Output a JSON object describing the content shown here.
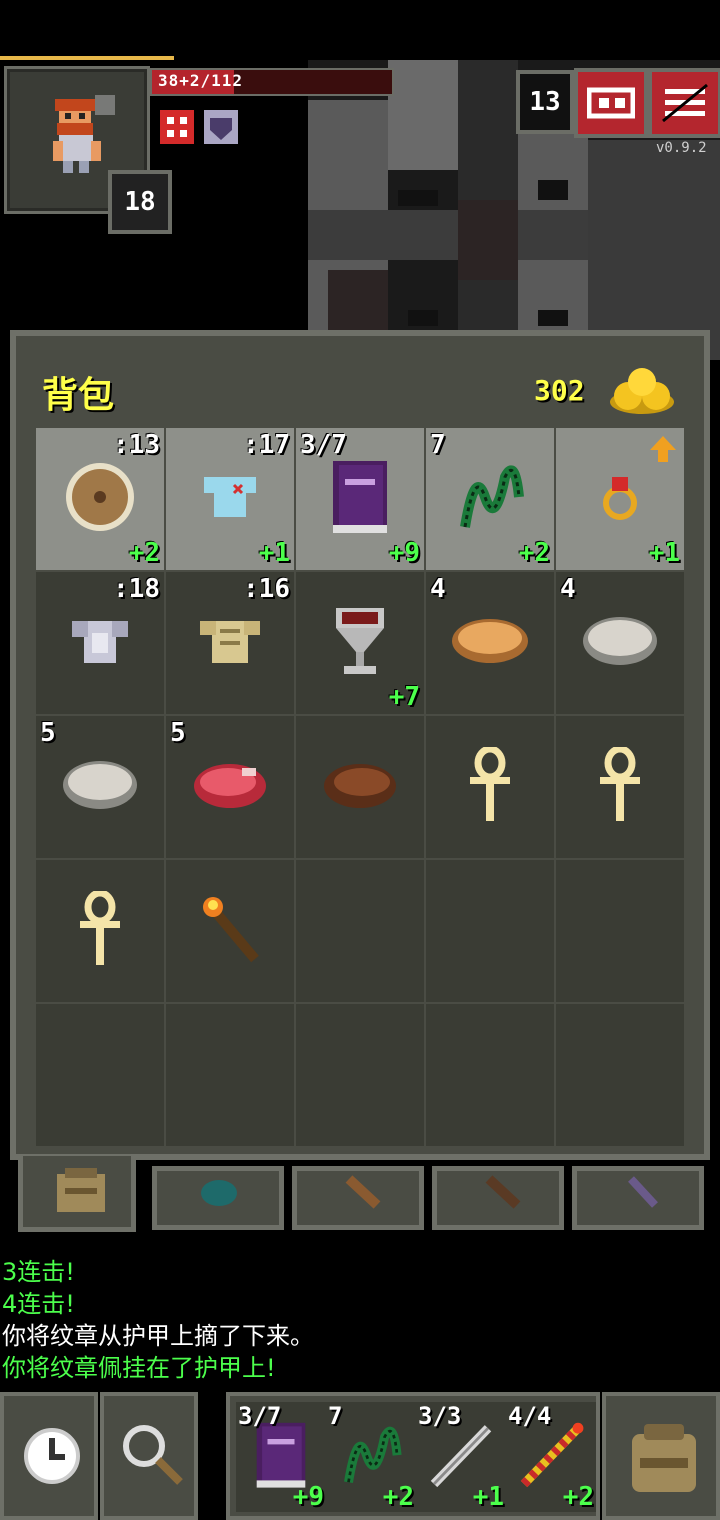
{
  "hud": {
    "hp_text": "38+2/112",
    "hp_fraction": 0.34,
    "level": "18",
    "depth": "13",
    "version": "v0.9.2"
  },
  "bag": {
    "title": "背包",
    "gold": "302",
    "slots": [
      {
        "tl": "",
        "tr": ":13",
        "br": "+2",
        "icon": "round-shield-icon",
        "equipped": true
      },
      {
        "tl": "",
        "tr": ":17",
        "br": "+1",
        "icon": "cloth-armor-icon",
        "equipped": true
      },
      {
        "tl": "3/7",
        "tr": "",
        "br": "+9",
        "icon": "spellbook-icon",
        "equipped": true
      },
      {
        "tl": "7",
        "tr": "",
        "br": "+2",
        "icon": "green-chain-icon",
        "equipped": true
      },
      {
        "tl": "",
        "tr": "",
        "br": "+1",
        "icon": "ruby-ring-icon",
        "equipped": true
      },
      {
        "tl": "",
        "tr": ":18",
        "br": "",
        "icon": "plate-armor-icon",
        "equipped": false
      },
      {
        "tl": "",
        "tr": ":16",
        "br": "",
        "icon": "scale-armor-icon",
        "equipped": false
      },
      {
        "tl": "",
        "tr": "",
        "br": "+7",
        "icon": "chalice-icon",
        "equipped": false
      },
      {
        "tl": "4",
        "tr": "",
        "br": "",
        "icon": "pasty-icon",
        "equipped": false
      },
      {
        "tl": "4",
        "tr": "",
        "br": "",
        "icon": "stone-icon",
        "equipped": false
      },
      {
        "tl": "5",
        "tr": "",
        "br": "",
        "icon": "stone-icon",
        "equipped": false
      },
      {
        "tl": "5",
        "tr": "",
        "br": "",
        "icon": "raw-meat-icon",
        "equipped": false
      },
      {
        "tl": "",
        "tr": "",
        "br": "",
        "icon": "cooked-meat-icon",
        "equipped": false
      },
      {
        "tl": "",
        "tr": "",
        "br": "",
        "icon": "ankh-icon",
        "equipped": false
      },
      {
        "tl": "",
        "tr": "",
        "br": "",
        "icon": "ankh-icon",
        "equipped": false
      },
      {
        "tl": "",
        "tr": "",
        "br": "",
        "icon": "ankh-icon",
        "equipped": false
      },
      {
        "tl": "",
        "tr": "",
        "br": "",
        "icon": "torch-icon",
        "equipped": false
      },
      {
        "tl": "",
        "tr": "",
        "br": "",
        "icon": "",
        "equipped": false
      },
      {
        "tl": "",
        "tr": "",
        "br": "",
        "icon": "",
        "equipped": false
      },
      {
        "tl": "",
        "tr": "",
        "br": "",
        "icon": "",
        "equipped": false
      },
      {
        "tl": "",
        "tr": "",
        "br": "",
        "icon": "",
        "equipped": false
      },
      {
        "tl": "",
        "tr": "",
        "br": "",
        "icon": "",
        "equipped": false
      },
      {
        "tl": "",
        "tr": "",
        "br": "",
        "icon": "",
        "equipped": false
      },
      {
        "tl": "",
        "tr": "",
        "br": "",
        "icon": "",
        "equipped": false
      },
      {
        "tl": "",
        "tr": "",
        "br": "",
        "icon": "",
        "equipped": false
      }
    ]
  },
  "log": [
    {
      "text": "3连击!",
      "color": "green"
    },
    {
      "text": "4连击!",
      "color": "green"
    },
    {
      "text": "你将纹章从护甲上摘了下来。",
      "color": "white"
    },
    {
      "text": "你将纹章佩挂在了护甲上!",
      "color": "green"
    }
  ],
  "quickslots": [
    {
      "tl": "3/7",
      "br": "+9",
      "icon": "spellbook-icon"
    },
    {
      "tl": "7",
      "br": "+2",
      "icon": "green-chain-icon"
    },
    {
      "tl": "3/3",
      "br": "+1",
      "icon": "silver-wand-icon"
    },
    {
      "tl": "4/4",
      "br": "+2",
      "icon": "striped-wand-icon"
    }
  ]
}
